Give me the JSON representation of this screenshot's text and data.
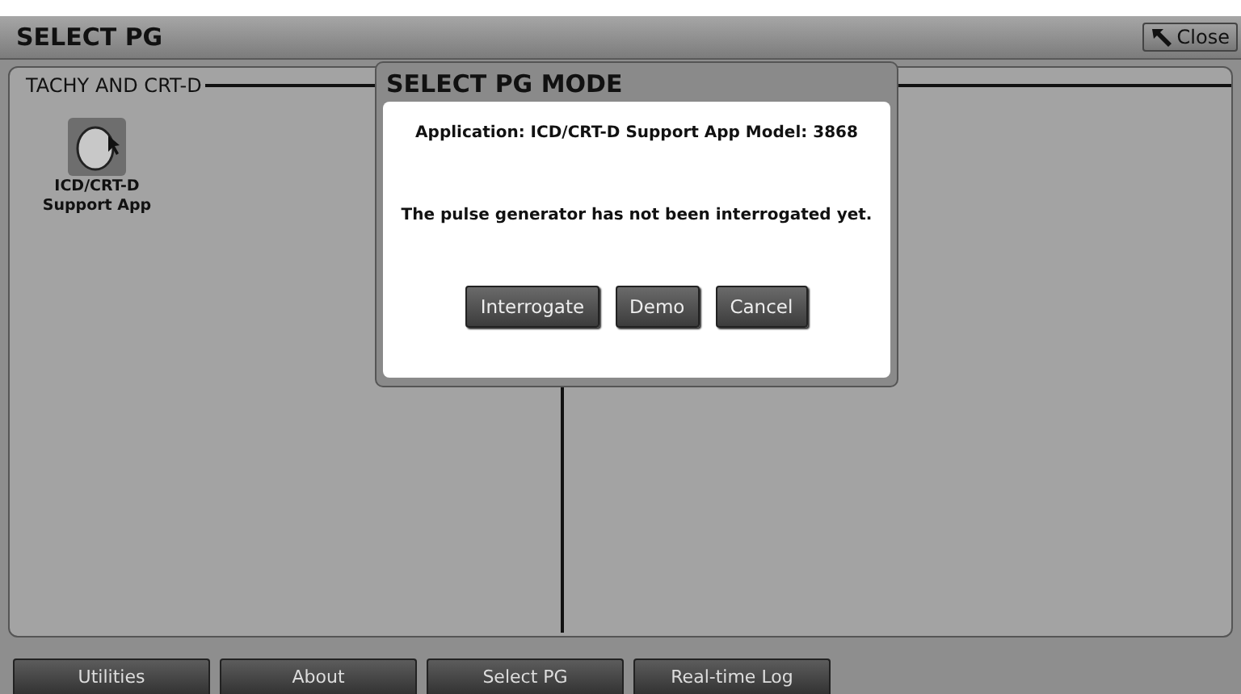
{
  "window": {
    "title": "SELECT PG",
    "close_button": "Close"
  },
  "group": {
    "title": "TACHY AND CRT-D",
    "apps": [
      {
        "label": "ICD/CRT-D Support App"
      }
    ]
  },
  "dialog": {
    "title": "SELECT PG MODE",
    "application_line": "Application: ICD/CRT-D Support App Model: 3868",
    "message": "The pulse generator has not been interrogated yet.",
    "buttons": [
      "Interrogate",
      "Demo",
      "Cancel"
    ]
  },
  "bottom_bar": [
    "Utilities",
    "About",
    "Select PG",
    "Real-time Log"
  ]
}
